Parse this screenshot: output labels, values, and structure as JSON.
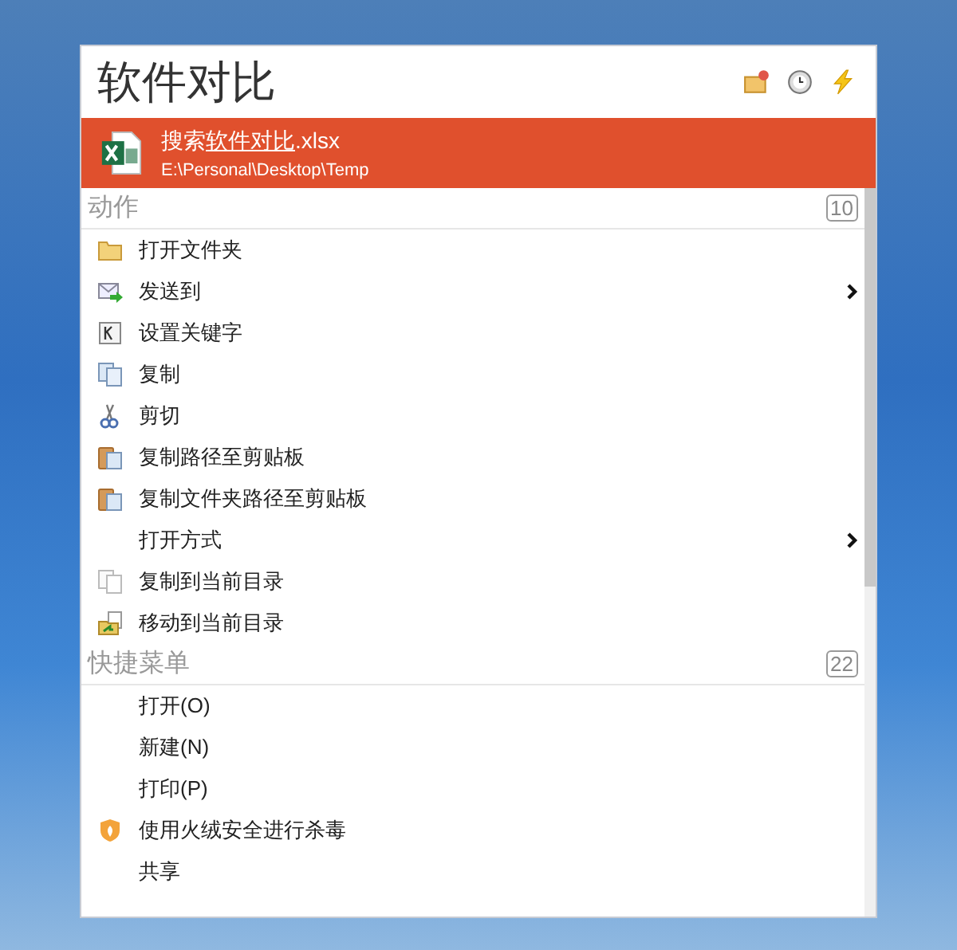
{
  "window": {
    "title": "软件对比"
  },
  "result": {
    "name_parts": [
      {
        "text": "搜索",
        "match": false
      },
      {
        "text": "软件对比",
        "match": true
      },
      {
        "text": ".xlsx",
        "match": false
      }
    ],
    "path": "E:\\Personal\\Desktop\\Temp"
  },
  "sections": [
    {
      "title": "动作",
      "count": "10",
      "items": [
        {
          "label": "打开文件夹",
          "kind": "folder",
          "submenu": false
        },
        {
          "label": "发送到",
          "kind": "send",
          "submenu": true
        },
        {
          "label": "设置关键字",
          "kind": "key",
          "submenu": false
        },
        {
          "label": "复制",
          "kind": "copy",
          "submenu": false
        },
        {
          "label": "剪切",
          "kind": "scissors",
          "submenu": false
        },
        {
          "label": "复制路径至剪贴板",
          "kind": "clipboard",
          "submenu": false
        },
        {
          "label": "复制文件夹路径至剪贴板",
          "kind": "clipboard",
          "submenu": false
        },
        {
          "label": "打开方式",
          "kind": "plain",
          "submenu": true
        },
        {
          "label": "复制到当前目录",
          "kind": "faded",
          "submenu": false
        },
        {
          "label": "移动到当前目录",
          "kind": "move",
          "submenu": false
        }
      ]
    },
    {
      "title": "快捷菜单",
      "count": "22",
      "items": [
        {
          "label": "打开(O)",
          "kind": "plain",
          "submenu": false
        },
        {
          "label": "新建(N)",
          "kind": "plain",
          "submenu": false
        },
        {
          "label": "打印(P)",
          "kind": "plain",
          "submenu": false
        },
        {
          "label": "使用火绒安全进行杀毒",
          "kind": "shield",
          "submenu": false
        },
        {
          "label": "共享",
          "kind": "plain",
          "submenu": false
        }
      ]
    }
  ]
}
